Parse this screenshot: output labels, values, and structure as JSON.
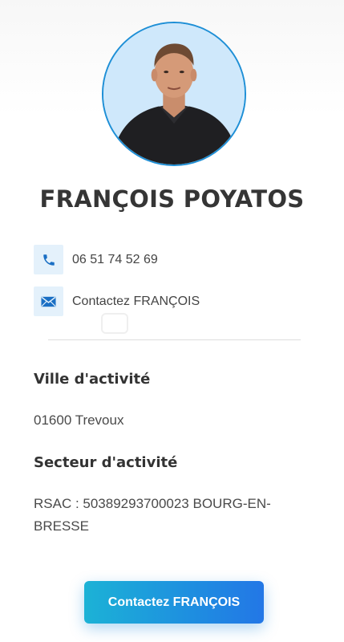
{
  "profile": {
    "name": "FRANÇOIS POYATOS",
    "avatar_alt": "profile-photo"
  },
  "contacts": {
    "phone": "06 51 74 52 69",
    "email_label": "Contactez FRANÇOIS"
  },
  "ville": {
    "title": "Ville d'activité",
    "value": "01600 Trevoux"
  },
  "secteur": {
    "title": "Secteur d'activité",
    "value": "RSAC : 50389293700023 BOURG-EN-BRESSE"
  },
  "cta": {
    "label": "Contactez FRANÇOIS"
  },
  "colors": {
    "accent": "#1e8fd6",
    "icon_bg": "#e4f1fb",
    "cta_start": "#1cb2d6",
    "cta_end": "#2377e6",
    "name_text": "#353535"
  },
  "icons": {
    "phone": "phone-icon",
    "email": "envelope-icon"
  }
}
